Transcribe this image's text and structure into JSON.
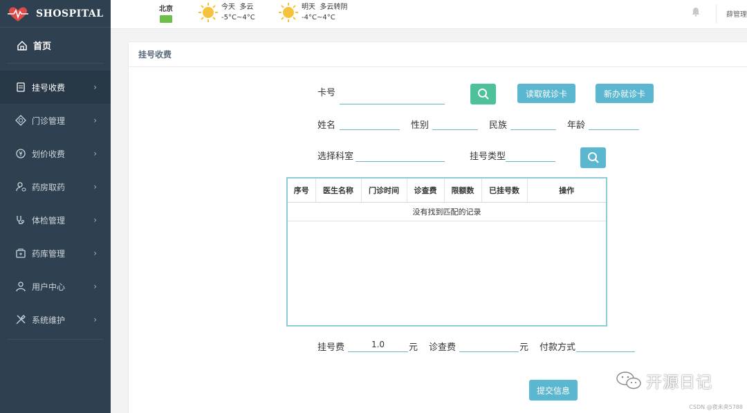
{
  "brand": {
    "name": "SHOSPITAL"
  },
  "sidebar": {
    "home": "首页",
    "items": [
      {
        "label": "挂号收费",
        "icon": "receipt-icon"
      },
      {
        "label": "门诊管理",
        "icon": "clinic-icon"
      },
      {
        "label": "划价收费",
        "icon": "coin-icon"
      },
      {
        "label": "药房取药",
        "icon": "pharmacy-user-icon"
      },
      {
        "label": "体检管理",
        "icon": "stethoscope-icon"
      },
      {
        "label": "药库管理",
        "icon": "medicine-box-icon"
      },
      {
        "label": "用户中心",
        "icon": "user-icon"
      },
      {
        "label": "系统维护",
        "icon": "tools-icon"
      }
    ],
    "chevron": "›"
  },
  "topbar": {
    "city": "北京",
    "today": {
      "day": "今天",
      "cond": "多云",
      "temp": "-5°C~4°C"
    },
    "tomorrow": {
      "day": "明天",
      "cond": "多云转阴",
      "temp": "-4°C~4°C"
    },
    "user": "薛管理员"
  },
  "panel": {
    "title": "挂号收费"
  },
  "form": {
    "card_label": "卡号",
    "read_card": "读取就诊卡",
    "new_card": "新办就诊卡",
    "name_label": "姓名",
    "gender_label": "性别",
    "ethnicity_label": "民族",
    "age_label": "年龄",
    "dept_label": "选择科室",
    "reg_type_label": "挂号类型",
    "reg_fee_label": "挂号费",
    "reg_fee_value": "1.0",
    "yuan": "元",
    "consult_fee_label": "诊查费",
    "payment_label": "付款方式",
    "submit": "提交信息"
  },
  "table": {
    "columns": [
      "序号",
      "医生名称",
      "门诊时间",
      "诊查费",
      "限额数",
      "已挂号数",
      "操作"
    ],
    "empty_text": "没有找到匹配的记录"
  },
  "watermark": {
    "text": "开源日记",
    "source": "CSDN @夜未央5788"
  },
  "colors": {
    "sidebar": "#2f4050",
    "accent": "#5bb6cf",
    "green": "#4ec19a"
  }
}
